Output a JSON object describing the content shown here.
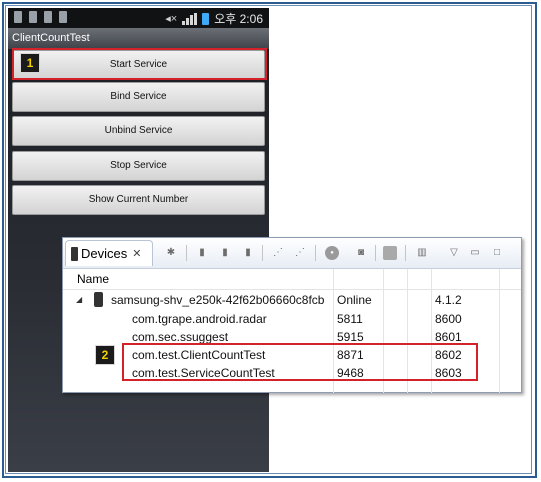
{
  "phone": {
    "clock": "오후 2:06",
    "app_title": "ClientCountTest",
    "buttons": [
      "Start Service",
      "Bind Service",
      "Unbind Service",
      "Stop Service",
      "Show Current Number"
    ]
  },
  "callouts": {
    "one": "1",
    "two": "2"
  },
  "devices_view": {
    "tab_label": "Devices",
    "tab_close": "✕",
    "column_header": "Name",
    "device": {
      "name": "samsung-shv_e250k-42f62b06660c8fcb",
      "state": "Online",
      "version": "4.1.2"
    },
    "processes": [
      {
        "name": "com.tgrape.android.radar",
        "pid": "5811",
        "port": "8600"
      },
      {
        "name": "com.sec.ssuggest",
        "pid": "5915",
        "port": "8601"
      },
      {
        "name": "com.test.ClientCountTest",
        "pid": "8871",
        "port": "8602"
      },
      {
        "name": "com.test.ServiceCountTest",
        "pid": "9468",
        "port": "8603"
      }
    ]
  },
  "colors": {
    "highlight": "#d4222a",
    "frame": "#2b5c91"
  }
}
